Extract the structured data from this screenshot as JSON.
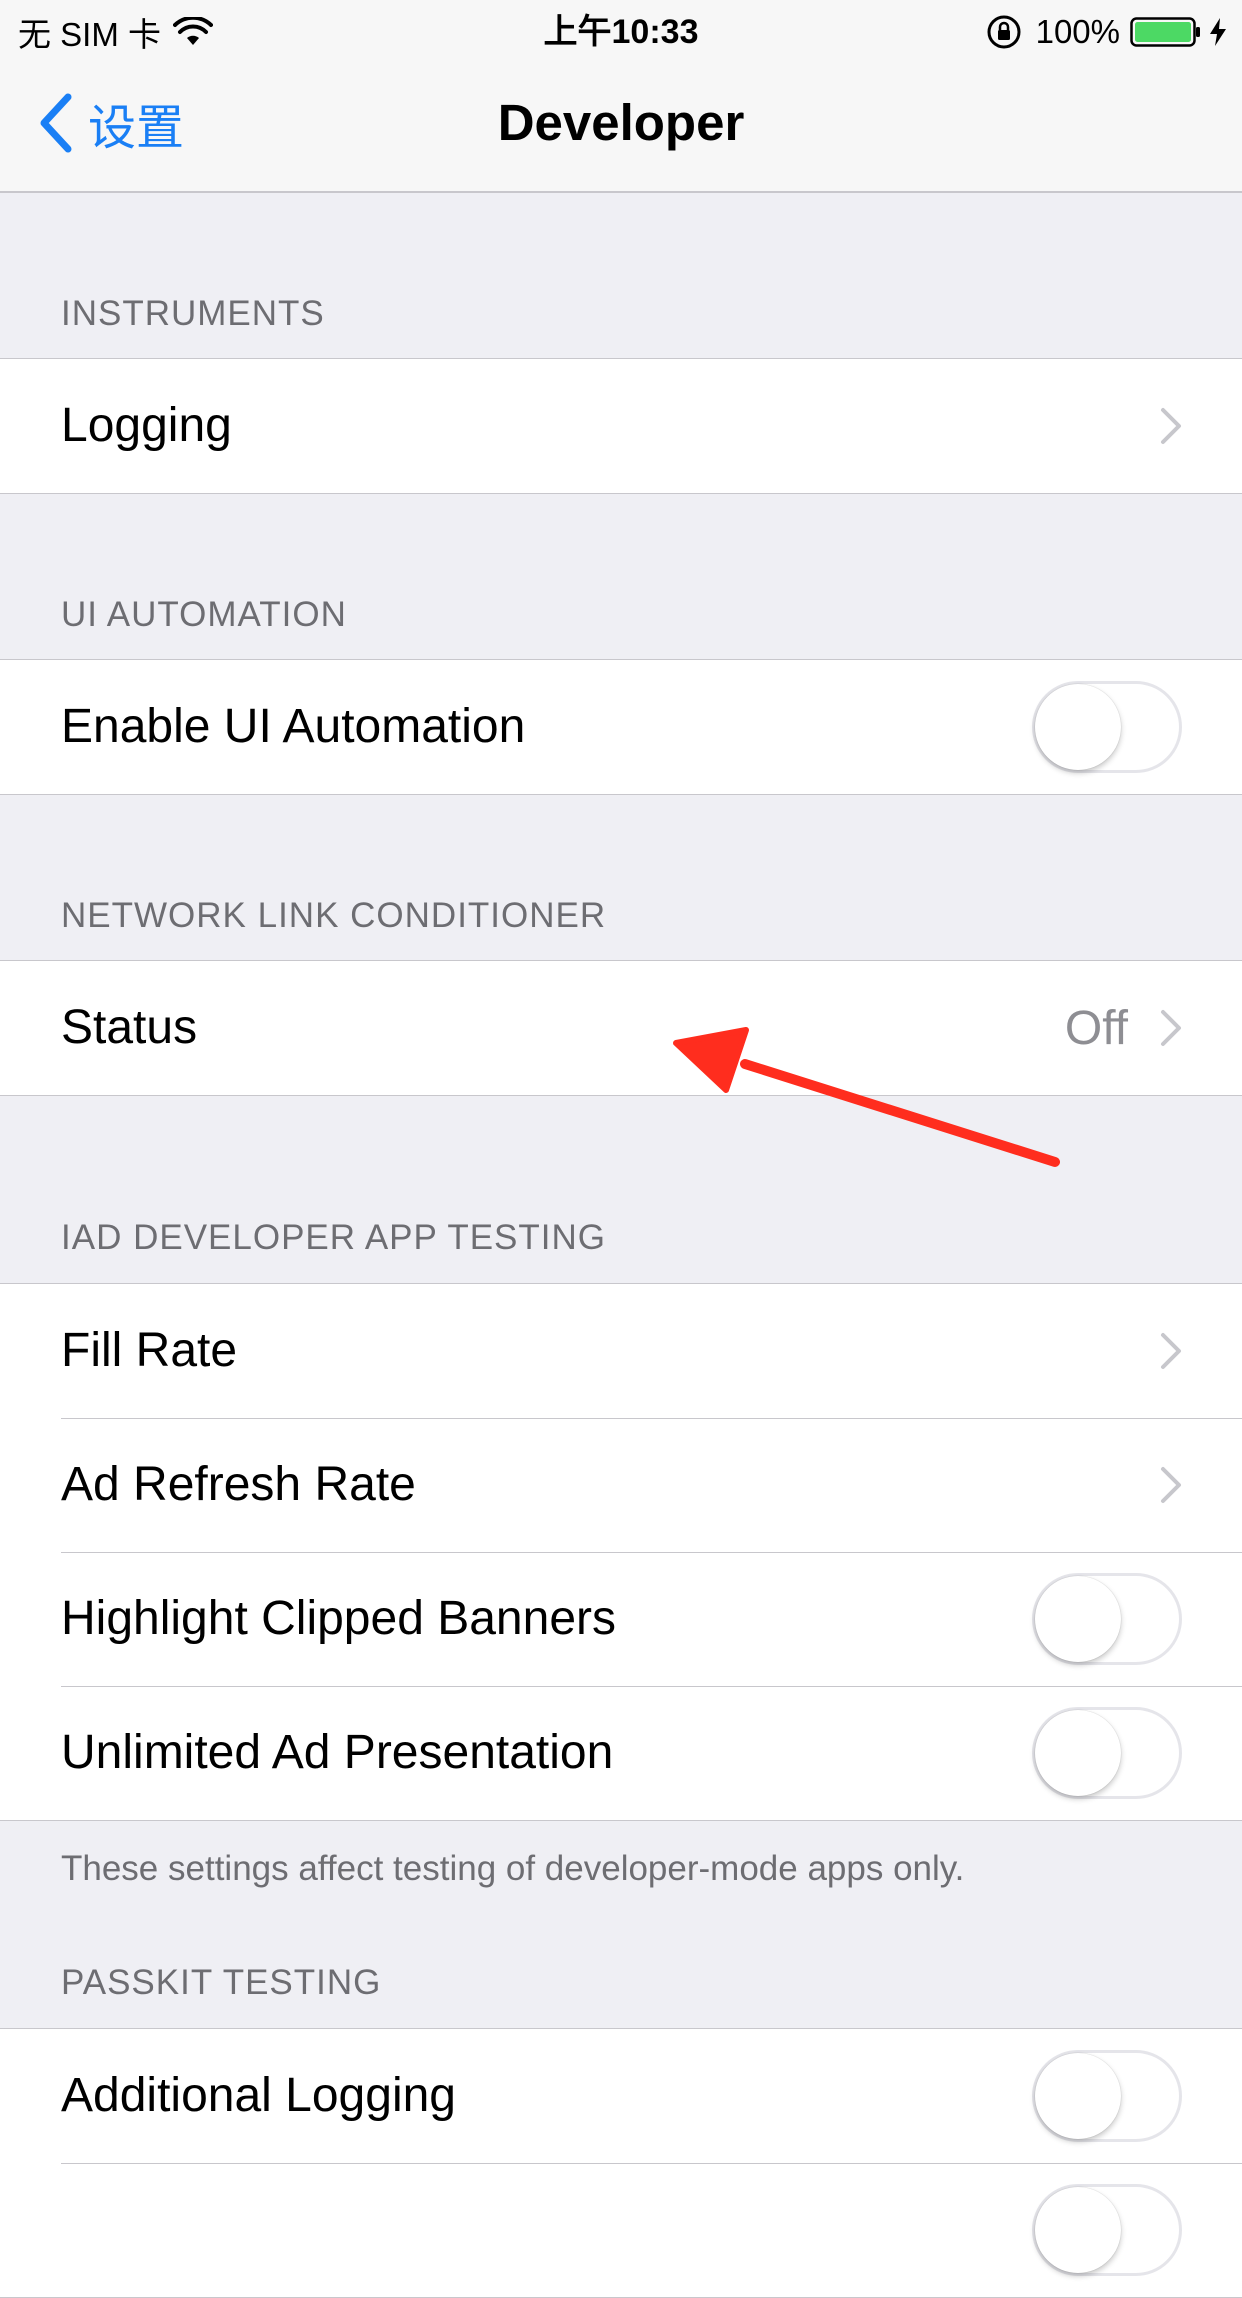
{
  "status_bar": {
    "carrier": "无 SIM 卡",
    "time": "上午10:33",
    "battery_percent": "100%",
    "battery_level": 1.0,
    "battery_color": "#4CD964"
  },
  "nav": {
    "back_label": "设置",
    "title": "Developer",
    "tint_color": "#1A7FF5"
  },
  "sections": {
    "instruments": {
      "header": "INSTRUMENTS",
      "rows": [
        {
          "label": "Logging",
          "accessory": "chevron"
        }
      ]
    },
    "ui_automation": {
      "header": "UI AUTOMATION",
      "rows": [
        {
          "label": "Enable UI Automation",
          "accessory": "toggle",
          "on": false
        }
      ]
    },
    "network_link_conditioner": {
      "header": "NETWORK LINK CONDITIONER",
      "rows": [
        {
          "label": "Status",
          "value": "Off",
          "accessory": "chevron"
        }
      ]
    },
    "iad": {
      "header": "IAD DEVELOPER APP TESTING",
      "rows": [
        {
          "label": "Fill Rate",
          "accessory": "chevron"
        },
        {
          "label": "Ad Refresh Rate",
          "accessory": "chevron"
        },
        {
          "label": "Highlight Clipped Banners",
          "accessory": "toggle",
          "on": false
        },
        {
          "label": "Unlimited Ad Presentation",
          "accessory": "toggle",
          "on": false
        }
      ],
      "footer": "These settings affect testing of developer-mode apps only."
    },
    "passkit": {
      "header": "PASSKIT TESTING",
      "rows": [
        {
          "label": "Additional Logging",
          "accessory": "toggle",
          "on": false
        },
        {
          "label": "",
          "accessory": "toggle",
          "on": false
        }
      ]
    }
  },
  "annotation": {
    "arrow_color": "#FF2D1E",
    "icon": "red-arrow-icon"
  }
}
